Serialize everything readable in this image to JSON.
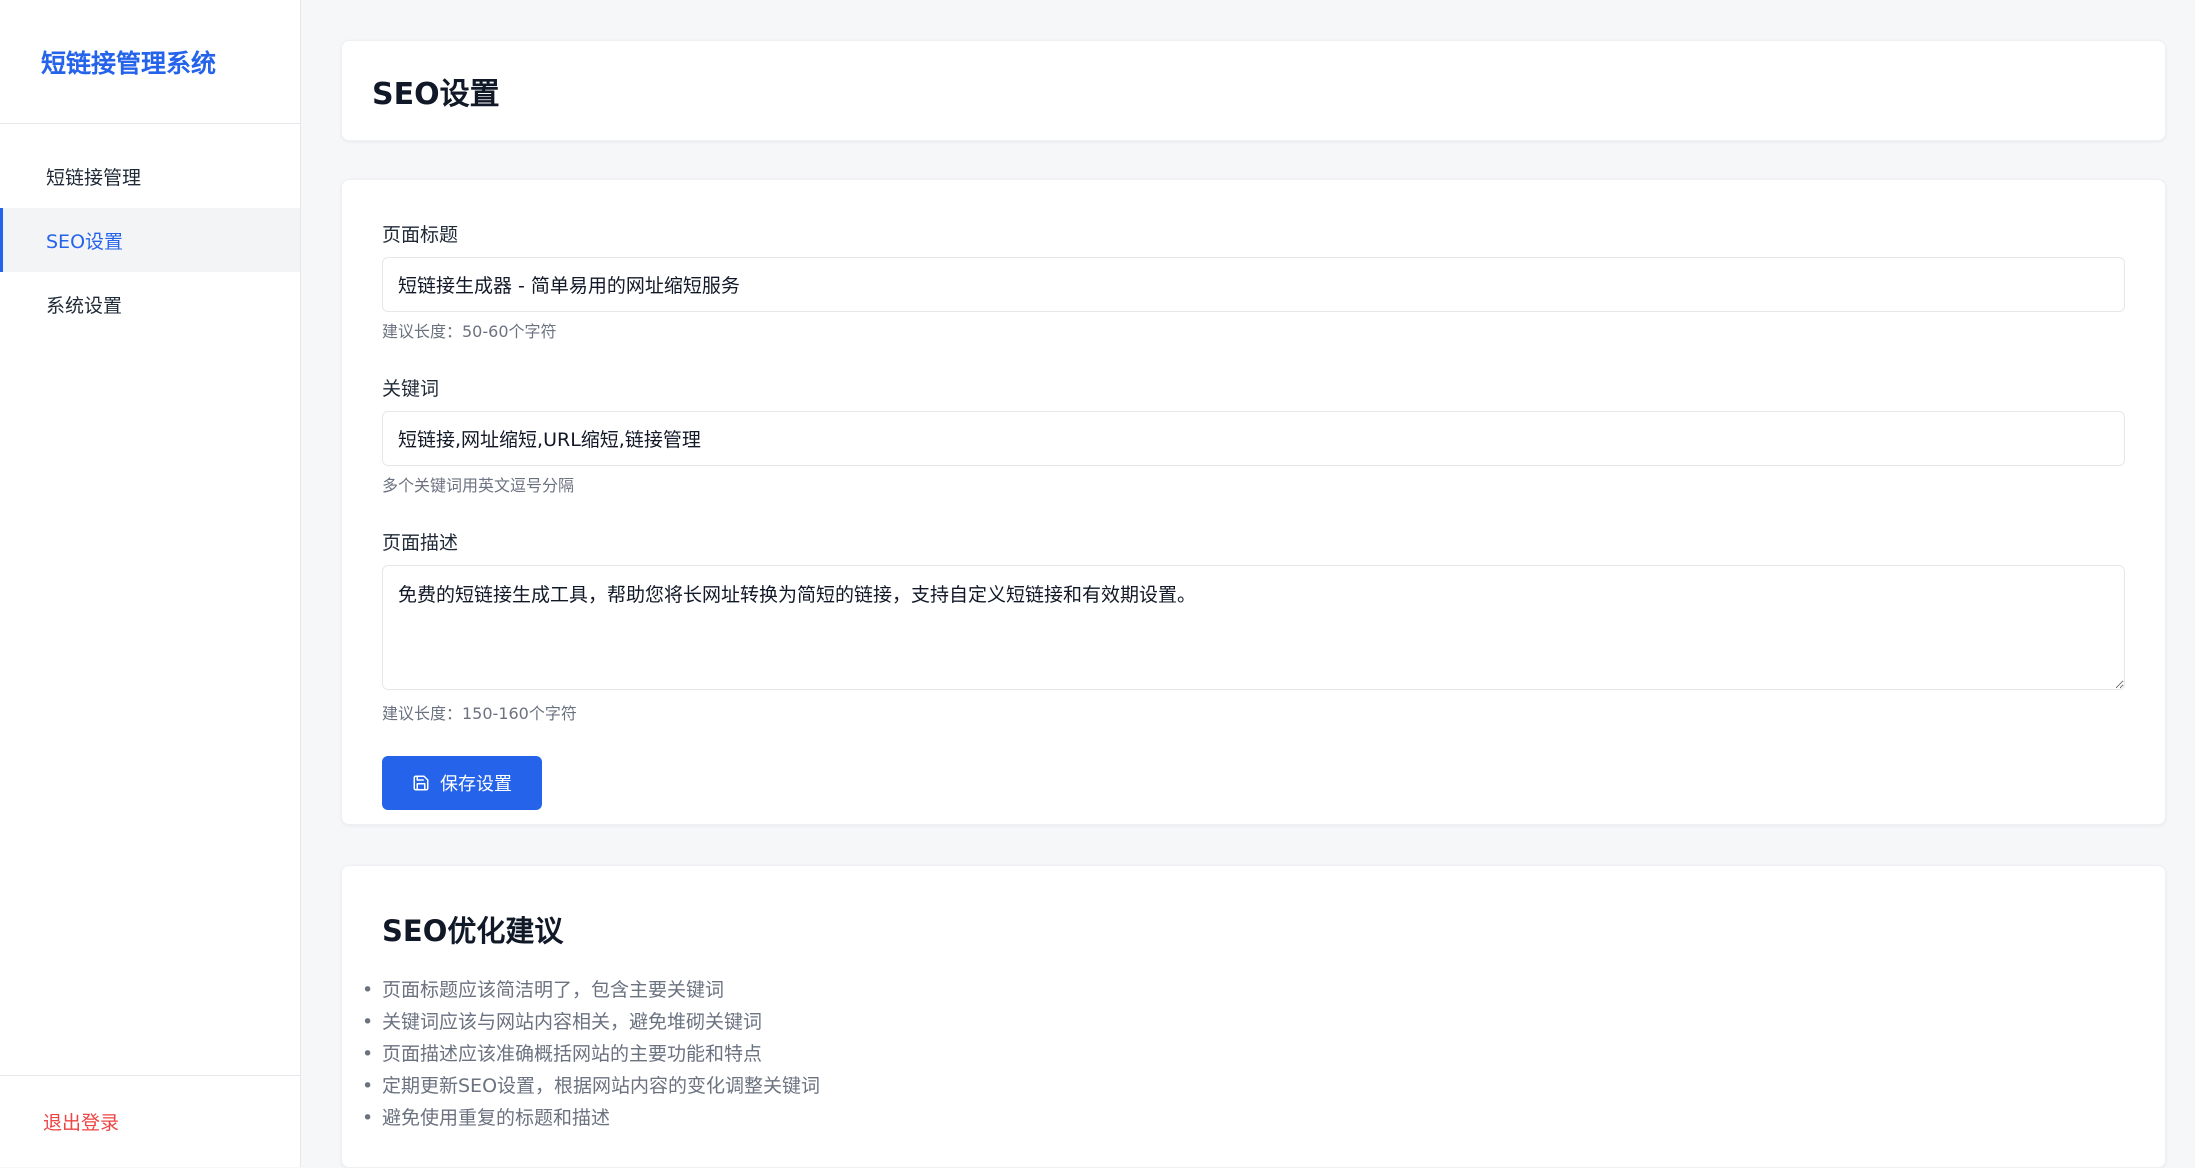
{
  "sidebar": {
    "brand": "短链接管理系统",
    "items": [
      {
        "label": "短链接管理"
      },
      {
        "label": "SEO设置"
      },
      {
        "label": "系统设置"
      }
    ],
    "logout": "退出登录"
  },
  "header": {
    "title": "SEO设置"
  },
  "form": {
    "title_label": "页面标题",
    "title_value": "短链接生成器 - 简单易用的网址缩短服务",
    "title_hint": "建议长度：50-60个字符",
    "keywords_label": "关键词",
    "keywords_value": "短链接,网址缩短,URL缩短,链接管理",
    "keywords_hint": "多个关键词用英文逗号分隔",
    "desc_label": "页面描述",
    "desc_value": "免费的短链接生成工具，帮助您将长网址转换为简短的链接，支持自定义短链接和有效期设置。",
    "desc_hint": "建议长度：150-160个字符",
    "save_label": "保存设置"
  },
  "tips": {
    "title": "SEO优化建议",
    "items": [
      "页面标题应该简洁明了，包含主要关键词",
      "关键词应该与网站内容相关，避免堆砌关键词",
      "页面描述应该准确概括网站的主要功能和特点",
      "定期更新SEO设置，根据网站内容的变化调整关键词",
      "避免使用重复的标题和描述"
    ]
  },
  "colors": {
    "accent": "#2563eb",
    "danger": "#ef4444",
    "background": "#f6f7f9"
  },
  "icons": {
    "save": "floppy-disk-icon"
  }
}
